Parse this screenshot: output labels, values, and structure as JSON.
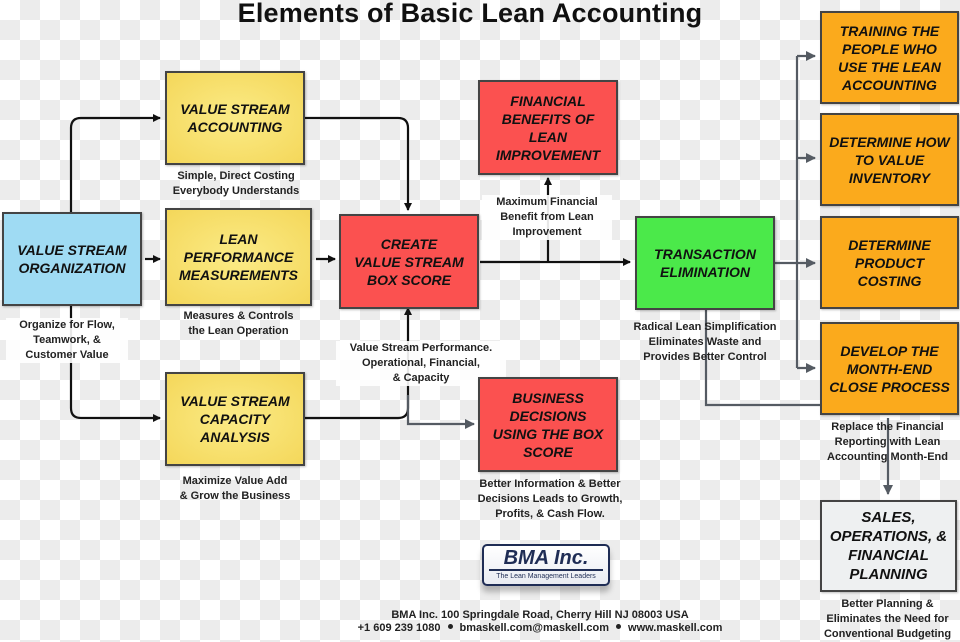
{
  "title": "Elements of Basic Lean Accounting",
  "boxes": {
    "vs_org": {
      "label": "VALUE STREAM\nORGANIZATION",
      "note": "Organize for Flow,\nTeamwork, &\nCustomer Value"
    },
    "vs_accounting": {
      "label": "VALUE STREAM\nACCOUNTING",
      "note": "Simple, Direct Costing\nEverybody Understands"
    },
    "lean_perf": {
      "label": "LEAN\nPERFORMANCE\nMEASUREMENTS",
      "note": "Measures & Controls\nthe Lean Operation"
    },
    "vs_capacity": {
      "label": "VALUE STREAM\nCAPACITY\nANALYSIS",
      "note": "Maximize Value Add\n& Grow the Business"
    },
    "box_score": {
      "label": "CREATE\nVALUE STREAM\nBOX SCORE",
      "note": "Value Stream Performance.\nOperational, Financial,\n& Capacity"
    },
    "financial_benefits": {
      "label": "FINANCIAL\nBENEFITS OF\nLEAN\nIMPROVEMENT",
      "note": "Maximum Financial\nBenefit from Lean\nImprovement"
    },
    "business_decisions": {
      "label": "BUSINESS\nDECISIONS\nUSING THE BOX\nSCORE",
      "note": "Better Information & Better\nDecisions Leads to Growth,\nProfits, & Cash Flow."
    },
    "transaction_elim": {
      "label": "TRANSACTION\nELIMINATION",
      "note": "Radical Lean Simplification\nEliminates Waste and\nProvides Better Control"
    },
    "training": {
      "label": "TRAINING THE\nPEOPLE WHO\nUSE THE LEAN\nACCOUNTING"
    },
    "inventory": {
      "label": "DETERMINE HOW\nTO VALUE\nINVENTORY"
    },
    "product_costing": {
      "label": "DETERMINE\nPRODUCT\nCOSTING"
    },
    "month_end": {
      "label": "DEVELOP THE\nMONTH-END\nCLOSE PROCESS",
      "note": "Replace the Financial\nReporting with Lean\nAccounting Month-End"
    },
    "sop": {
      "label": "SALES,\nOPERATIONS, &\nFINANCIAL\nPLANNING",
      "note": "Better Planning &\nEliminates the Need for\nConventional Budgeting"
    }
  },
  "colors": {
    "yellow": "#f4d75a",
    "red": "#fb5150",
    "blue": "#9fdbf3",
    "green": "#4be94a",
    "orange": "#fbaa1c",
    "grey": "#eef0f1",
    "brand_navy": "#1f2d55"
  },
  "logo": {
    "name": "BMA Inc.",
    "tagline": "The Lean Management Leaders"
  },
  "footer": {
    "address": "BMA Inc. 100 Springdale Road, Cherry Hill NJ 08003 USA",
    "phone": "+1 609 239 1080",
    "email": "bmaskell.com@maskell.com",
    "website": "www.maskell.com"
  }
}
